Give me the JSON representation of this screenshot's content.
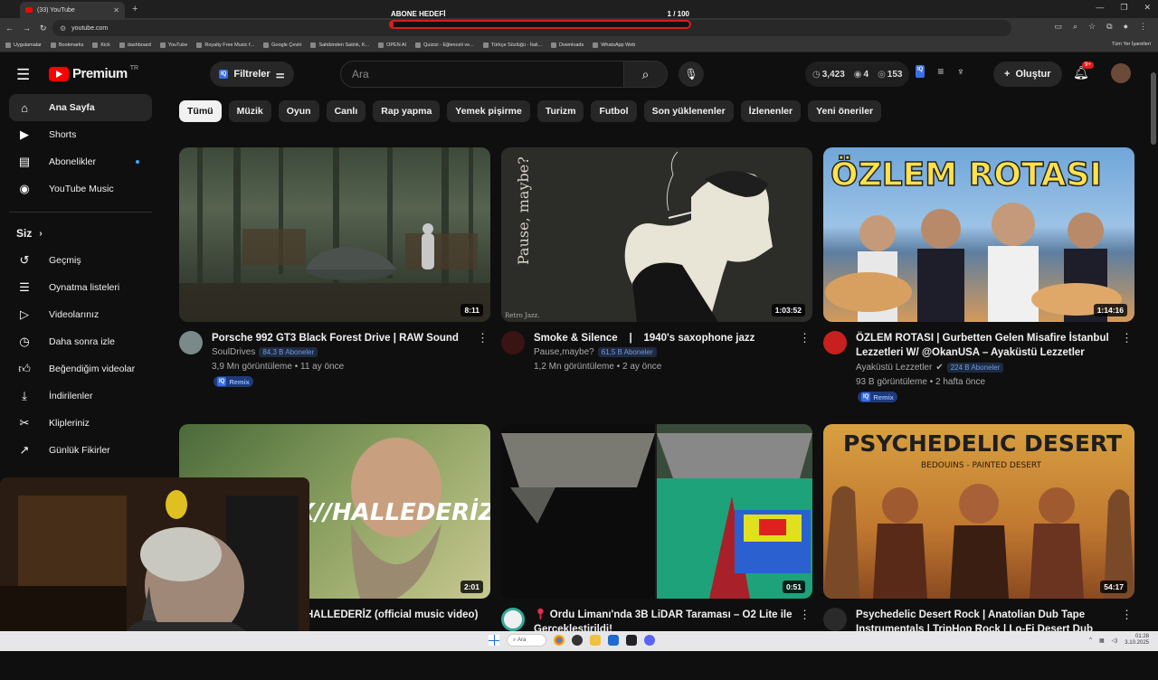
{
  "browser": {
    "tab_title": "(33) YouTube",
    "url": "youtube.com",
    "bookmarks": [
      "Uygulamalar",
      "Bookmarks",
      "Kick",
      "dashboard",
      "YouTube",
      "Royalty Free Music f...",
      "Google Çeviri",
      "Sahibinden Satılık, K...",
      "OPEN AI",
      "Quizizi - Eğlenceli ve...",
      "Türkçe Sözlüğü - İtali...",
      "Downloads",
      "WhatsApp Web"
    ],
    "bookmarks_all": "Tüm Yer İşaretleri"
  },
  "goal_overlay": {
    "label": "ABONE HEDEFİ",
    "count": "1 / 100",
    "progress": 0.01
  },
  "header": {
    "logo_text": "Premium",
    "region": "TR",
    "filters_label": "Filtreler",
    "filters_badge": "IQ",
    "search_placeholder": "Ara",
    "stat_1": "3,423",
    "stat_2": "4",
    "stat_3": "153",
    "create_label": "Oluştur",
    "notification_count": "9+"
  },
  "sidebar": {
    "main": [
      {
        "label": "Ana Sayfa",
        "icon": "home-icon"
      },
      {
        "label": "Shorts",
        "icon": "shorts-icon"
      },
      {
        "label": "Abonelikler",
        "icon": "subscriptions-icon"
      },
      {
        "label": "YouTube Music",
        "icon": "music-icon"
      }
    ],
    "you_heading": "Siz",
    "you": [
      {
        "label": "Geçmiş",
        "icon": "history-icon"
      },
      {
        "label": "Oynatma listeleri",
        "icon": "playlist-icon"
      },
      {
        "label": "Videolarınız",
        "icon": "video-icon"
      },
      {
        "label": "Daha sonra izle",
        "icon": "clock-icon"
      },
      {
        "label": "Beğendiğim videolar",
        "icon": "thumbs-up-icon"
      },
      {
        "label": "İndirilenler",
        "icon": "download-icon"
      },
      {
        "label": "Klipleriniz",
        "icon": "scissors-icon"
      },
      {
        "label": "Günlük Fikirler",
        "icon": "external-link-icon"
      }
    ]
  },
  "chips": [
    "Tümü",
    "Müzik",
    "Oyun",
    "Canlı",
    "Rap yapma",
    "Yemek pişirme",
    "Turizm",
    "Futbol",
    "Son yüklenenler",
    "İzlenenler",
    "Yeni öneriler"
  ],
  "videos": [
    {
      "title": "Porsche 992 GT3 Black Forest Drive | RAW Sound",
      "channel": "SoulDrives",
      "subs": "84,3 B Aboneler",
      "views": "3,9 Mn görüntüleme • 11 ay önce",
      "duration": "8:11",
      "remix": "Remix"
    },
    {
      "title": "Smoke & Silence    |    1940's saxophone jazz",
      "channel": "Pause,maybe?",
      "subs": "61,5 B Aboneler",
      "views": "1,2 Mn görüntüleme • 2 ay önce",
      "duration": "1:03:52",
      "thumb_text": "Pause, maybe?",
      "thumb_sub": "Retro Jazz."
    },
    {
      "title": "ÖZLEM ROTASI | Gurbetten Gelen Misafire İstanbul Lezzetleri W/ @OkanUSA  – Ayaküstü Lezzetler",
      "channel": "Ayaküstü Lezzetler",
      "subs": "224 B Aboneler",
      "views": "93 B görüntüleme • 2 hafta önce",
      "duration": "1:14:16",
      "remix": "Remix",
      "thumb_text": "ÖZLEM ROTASI"
    },
    {
      "title": "HALLEDERİZ (official music video)",
      "duration": "2:01",
      "thumb_text": "X//HALLEDERİZ"
    },
    {
      "title": "Ordu Limanı'nda 3B LiDAR Taraması – O2 Lite ile Gerçekleştirildi!",
      "duration": "0:51"
    },
    {
      "title": "Psychedelic Desert Rock | Anatolian Dub Tape Instrumentals | TripHop Rock | Lo-Fi Desert Dub",
      "duration": "54:17",
      "thumb_text": "PSYCHEDELIC DESERT",
      "thumb_sub": "BEDOUINS - PAINTED DESERT"
    }
  ],
  "taskbar": {
    "search": "Ara",
    "time": "01:28",
    "date": "3.10.2025"
  }
}
